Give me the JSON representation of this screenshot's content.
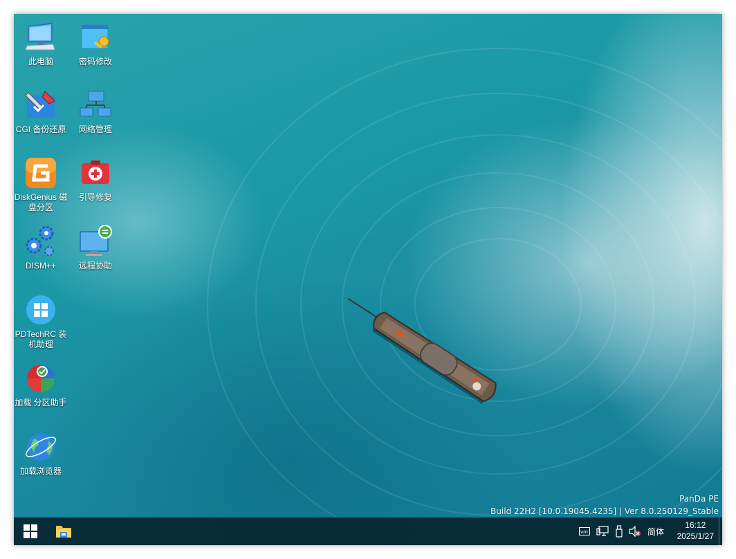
{
  "desktop_icons": [
    {
      "label": "此电脑",
      "icon": "computer-icon"
    },
    {
      "label": "密码修改",
      "icon": "password-key-icon"
    },
    {
      "label": "CGI 备份还原",
      "icon": "backup-tool-icon"
    },
    {
      "label": "网络管理",
      "icon": "network-icon"
    },
    {
      "label": "DiskGenius 磁盘分区",
      "icon": "diskgenius-icon"
    },
    {
      "label": "引导修复",
      "icon": "boot-repair-icon"
    },
    {
      "label": "DISM++",
      "icon": "gears-icon"
    },
    {
      "label": "远程协助",
      "icon": "remote-assist-icon"
    },
    {
      "label": "PDTechRC 装机助理",
      "icon": "windows-logo-icon"
    },
    {
      "label": "加载 分区助手",
      "icon": "partition-assistant-icon"
    },
    {
      "label": "加载浏览器",
      "icon": "browser-globe-icon"
    }
  ],
  "watermark": {
    "line1": "PanDa  PE",
    "line2": "Build  22H2  [10.0.19045.4235]  |  Ver  8.0.250129_Stable"
  },
  "taskbar": {
    "start_icon": "windows-start-icon",
    "pinned_icon": "file-explorer-icon",
    "tray_icons": [
      "vmware-icon",
      "network-monitor-icon",
      "usb-drive-icon",
      "speaker-muted-icon"
    ],
    "ime_label": "简体",
    "time": "16:12",
    "date": "2025/1/27"
  },
  "colors": {
    "water": "#1b98a6",
    "taskbar": "#082430",
    "text": "#ffffff"
  }
}
